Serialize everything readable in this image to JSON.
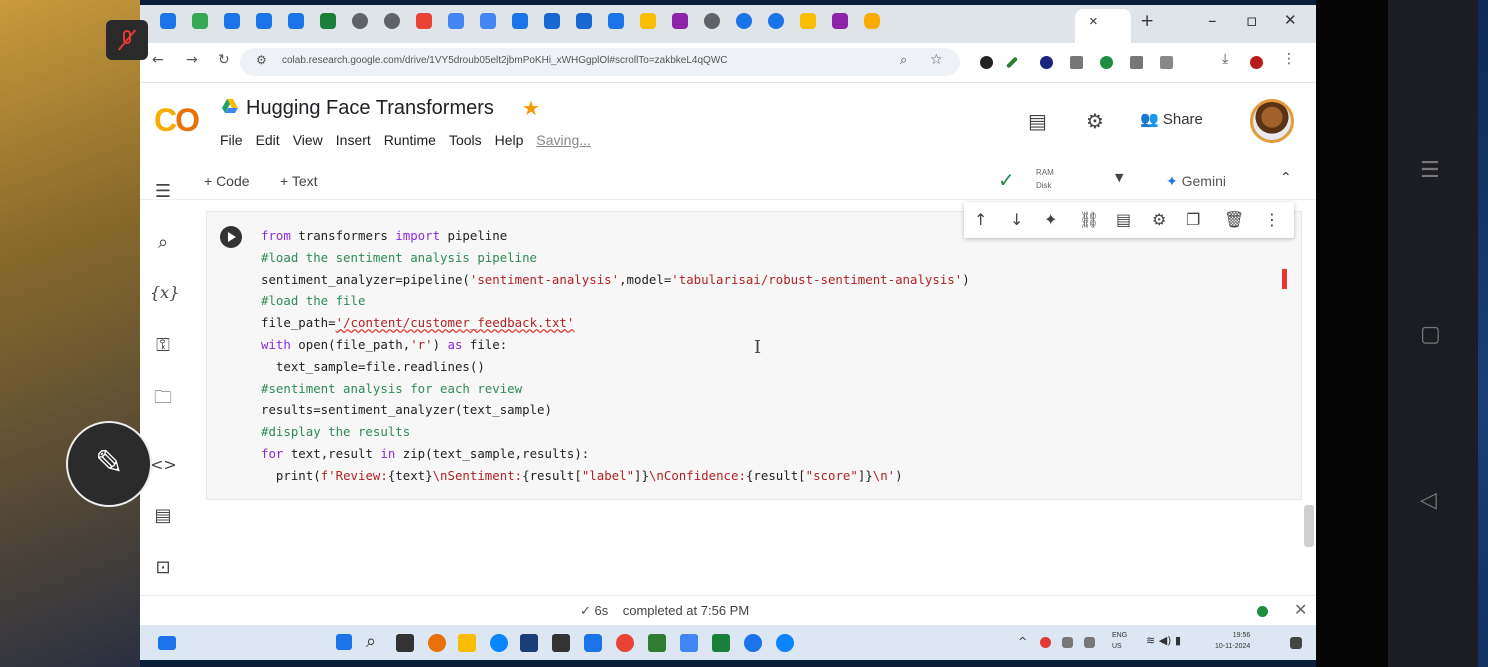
{
  "browser": {
    "new_tab": "+",
    "close_tab": "×",
    "minimize": "–",
    "restore": "▫",
    "close": "✕",
    "url": "colab.research.google.com/drive/1VY5droub05elt2jbmPoKHi_xWHGgplOl#scrollTo=zakbkeL4qQWC"
  },
  "colab": {
    "title": "Hugging Face Transformers",
    "menu": [
      "File",
      "Edit",
      "View",
      "Insert",
      "Runtime",
      "Tools",
      "Help"
    ],
    "saving": "Saving...",
    "share_label": "Share"
  },
  "toolbar": {
    "add_code": "+ Code",
    "add_text": "+ Text",
    "ram_label": "RAM",
    "disk_label": "Disk",
    "gemini_label": "Gemini"
  },
  "cell": {
    "lines": [
      "from transformers import pipeline",
      "#load the sentiment analysis pipeline",
      "sentiment_analyzer=pipeline('sentiment-analysis',model='tabularisai/robust-sentiment-analysis')",
      "#load the file",
      "file_path='/content/customer_feedback.txt'",
      "with open(file_path,'r') as file:",
      "  text_sample=file.readlines()",
      "#sentiment analysis for each review",
      "results=sentiment_analyzer(text_sample)",
      "#display the results",
      "for text,result in zip(text_sample,results):",
      "  print(f'Review:{text}\\nSentiment:{result[\"label\"]}\\nConfidence:{result[\"score\"]}\\n')"
    ]
  },
  "status": {
    "check": "✓",
    "duration": "6s",
    "completed": "completed at 7:56 PM"
  },
  "taskbar": {
    "lang_top": "ENG",
    "lang_bottom": "US",
    "time": "19:56",
    "date": "10-11-2024"
  },
  "colors": {
    "keyword": "#8a2be2",
    "comment": "#2e8b57",
    "string": "#b22222",
    "status_green": "#1e8e3e",
    "colab_orange": "#f9ab00"
  }
}
